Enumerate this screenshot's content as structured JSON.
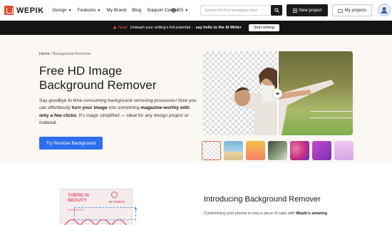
{
  "nav": {
    "brand": "WEPIK",
    "menu": [
      {
        "label": "Design",
        "has_dropdown": true
      },
      {
        "label": "Features",
        "has_dropdown": true
      },
      {
        "label": "My Brand",
        "has_dropdown": false
      },
      {
        "label": "Blog",
        "has_dropdown": false
      },
      {
        "label": "Support Center",
        "has_dropdown": false
      }
    ],
    "language": "EN",
    "search_placeholder": "Search for free templates here",
    "new_project": "New project",
    "my_projects": "My projects"
  },
  "banner": {
    "new_label": "New!",
    "text": "Unleash your writing's full potential -",
    "bold_text": "say hello to the AI Writer",
    "cta": "Start writing"
  },
  "hero": {
    "breadcrumb_home": "Home",
    "breadcrumb_sep": " / ",
    "breadcrumb_current": "Background Remover",
    "title": "Free HD Image Background Remover",
    "desc_1": "Say goodbye to time-consuming background removing processes! Now you can effortlessly ",
    "desc_b1": "turn your image",
    "desc_2": " into something ",
    "desc_b2": "magazine-worthy with only a few clicks",
    "desc_3": ". It's magic simplified — ideal for any design project or material.",
    "cta": "Try Remove Background"
  },
  "thumbnails": [
    {
      "name": "transparent",
      "selected": true
    },
    {
      "name": "beach",
      "colors": [
        "#7db6d9",
        "#e9d7a8"
      ]
    },
    {
      "name": "sunset-gradient",
      "colors": [
        "#f6c047",
        "#f2806a"
      ]
    },
    {
      "name": "room",
      "colors": [
        "#3d4a3a",
        "#8fa07d"
      ]
    },
    {
      "name": "abstract-pink",
      "colors": [
        "#c42f7a",
        "#f07ab0"
      ]
    },
    {
      "name": "violet-gradient",
      "colors": [
        "#7a2fb0",
        "#c44ad0"
      ]
    },
    {
      "name": "lilac-gradient",
      "colors": [
        "#d8a6e8",
        "#f3c5f0"
      ]
    }
  ],
  "section": {
    "title": "Introducing Background Remover",
    "intro": "Customizing your photos is now a piece of cake with",
    "intro_bold": "Wepik's amazing"
  },
  "card": {
    "line1": "THERE IS",
    "line2": "BEAUTY",
    "line3": "IN SIMPLICITY",
    "badge": "IN TOUCH"
  },
  "colors": {
    "accent": "#2e6ff1",
    "brand": "#e8472b",
    "banner_bg": "#141414",
    "new_red": "#ff5a4a"
  }
}
